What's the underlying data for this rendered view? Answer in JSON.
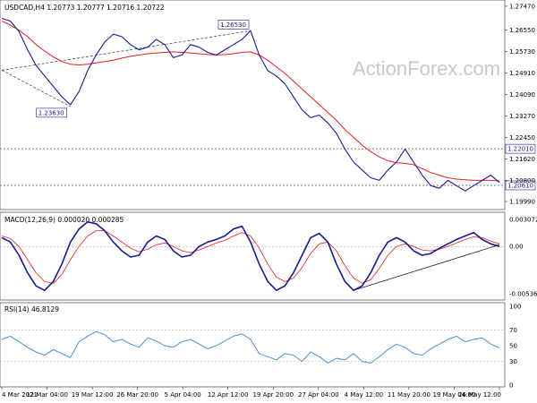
{
  "chart_data": [
    {
      "type": "line",
      "title": "USDCAD,H4  1.20773 1.20777 1.20716 1.20722",
      "watermark": "ActionForex.com",
      "x_ticks": [
        "4 Mar 2021",
        "12 Mar 04:00",
        "19 Mar 12:00",
        "26 Mar 20:00",
        "5 Apr 04:00",
        "12 Apr 12:00",
        "19 Apr 20:00",
        "27 Apr 04:00",
        "4 May 12:00",
        "11 May 20:00",
        "19 May 04:00",
        "26 May 12:00"
      ],
      "y_ticks": [
        "1.27470",
        "1.26550",
        "1.25730",
        "1.24910",
        "1.24090",
        "1.23270",
        "1.22450",
        "1.21620",
        "1.20800",
        "1.19990"
      ],
      "ylim": [
        1.1982,
        1.2757
      ],
      "price_color": "#1a1a8c",
      "ma_color": "#e02020",
      "price": [
        1.27,
        1.269,
        1.265,
        1.258,
        1.252,
        1.248,
        1.244,
        1.24,
        1.237,
        1.242,
        1.25,
        1.256,
        1.261,
        1.264,
        1.263,
        1.26,
        1.258,
        1.259,
        1.262,
        1.26,
        1.255,
        1.256,
        1.26,
        1.259,
        1.257,
        1.256,
        1.258,
        1.26,
        1.262,
        1.2653,
        1.256,
        1.25,
        1.248,
        1.245,
        1.24,
        1.235,
        1.232,
        1.233,
        1.23,
        1.226,
        1.22,
        1.215,
        1.212,
        1.209,
        1.208,
        1.212,
        1.215,
        1.22,
        1.215,
        1.21,
        1.206,
        1.205,
        1.208,
        1.206,
        1.204,
        1.206,
        1.208,
        1.21,
        1.2072
      ],
      "ma": [
        1.269,
        1.2675,
        1.2655,
        1.263,
        1.26,
        1.2575,
        1.2553,
        1.2535,
        1.2525,
        1.2522,
        1.2525,
        1.253,
        1.2535,
        1.254,
        1.2548,
        1.2555,
        1.256,
        1.2565,
        1.2568,
        1.257,
        1.2572,
        1.257,
        1.2568,
        1.2565,
        1.2562,
        1.256,
        1.2562,
        1.2565,
        1.257,
        1.2572,
        1.256,
        1.254,
        1.2515,
        1.249,
        1.246,
        1.243,
        1.24,
        1.237,
        1.234,
        1.231,
        1.2275,
        1.2245,
        1.2215,
        1.219,
        1.217,
        1.2155,
        1.2148,
        1.2145,
        1.214,
        1.2125,
        1.211,
        1.21,
        1.209,
        1.2085,
        1.2082,
        1.208,
        1.208,
        1.208,
        1.2078
      ],
      "swing_labels": [
        {
          "label": "1.23630",
          "value": 1.2363,
          "at_index": 8
        },
        {
          "label": "1.26530",
          "value": 1.2653,
          "at_index": 29
        }
      ],
      "trendline": {
        "from": {
          "index": 0,
          "value": 1.2502
        },
        "to": {
          "index": 29,
          "value": 1.2653
        }
      },
      "trendline_2": {
        "from": {
          "index": 0,
          "value": 1.2502
        },
        "to": {
          "index": 8,
          "value": 1.2363
        }
      },
      "horizontal_levels": [
        {
          "label": "1.22010",
          "value": 1.2201,
          "color": "#555555"
        },
        {
          "label": "1.20610",
          "value": 1.2061,
          "color": "#555555"
        }
      ]
    },
    {
      "type": "line",
      "title": "MACD(12,26,9) 0.000020 0.000285",
      "y_ticks": [
        "0.003072",
        "0.00",
        "-0.005369"
      ],
      "ylim": [
        -0.0058,
        0.0036
      ],
      "macd_color": "#1a1a8c",
      "signal_color": "#e02020",
      "macd": [
        0.001,
        0.0005,
        -0.001,
        -0.003,
        -0.0045,
        -0.005,
        -0.004,
        -0.002,
        0.0005,
        0.002,
        0.0028,
        0.0026,
        0.0018,
        0.0005,
        -0.0005,
        -0.0012,
        -0.001,
        0.0005,
        0.0012,
        0.0008,
        -0.0005,
        -0.0012,
        -0.001,
        0.0,
        0.0005,
        0.0008,
        0.0012,
        0.002,
        0.0023,
        0.0005,
        -0.002,
        -0.004,
        -0.005,
        -0.0045,
        -0.003,
        -0.001,
        0.001,
        0.0015,
        0.0005,
        -0.002,
        -0.004,
        -0.005,
        -0.0045,
        -0.003,
        -0.001,
        0.0005,
        0.001,
        0.0005,
        -0.0005,
        -0.001,
        -0.0008,
        -0.0002,
        0.0003,
        0.0008,
        0.0012,
        0.0016,
        0.0008,
        0.0003,
        0.0
      ],
      "signal": [
        0.0012,
        0.0009,
        0.0,
        -0.0015,
        -0.003,
        -0.004,
        -0.0042,
        -0.0032,
        -0.0015,
        0.0,
        0.0012,
        0.0018,
        0.0018,
        0.0012,
        0.0005,
        -0.0002,
        -0.0006,
        -0.0003,
        0.0002,
        0.0004,
        0.0,
        -0.0005,
        -0.0007,
        -0.0004,
        0.0,
        0.0004,
        0.0007,
        0.0012,
        0.0016,
        0.0012,
        -0.0002,
        -0.002,
        -0.0035,
        -0.004,
        -0.0036,
        -0.0024,
        -0.0008,
        0.0003,
        0.0005,
        -0.0005,
        -0.0022,
        -0.0036,
        -0.0042,
        -0.0038,
        -0.0025,
        -0.001,
        0.0,
        0.0003,
        0.0,
        -0.0004,
        -0.0005,
        -0.0003,
        0.0,
        0.0004,
        0.0008,
        0.0011,
        0.001,
        0.0006,
        0.0003
      ],
      "trendline": {
        "from": {
          "index": 41,
          "value": -0.005
        },
        "to": {
          "index": 58,
          "value": 0.0002
        }
      }
    },
    {
      "type": "line",
      "title": "RSI(14) 46.8129",
      "y_ticks": [
        "100",
        "70",
        "50",
        "30",
        "0"
      ],
      "ylim": [
        0,
        100
      ],
      "levels": [
        70,
        30
      ],
      "rsi_color": "#4a90d9",
      "rsi": [
        58,
        62,
        55,
        48,
        42,
        38,
        45,
        40,
        35,
        55,
        62,
        68,
        64,
        55,
        58,
        52,
        48,
        60,
        56,
        50,
        48,
        55,
        58,
        52,
        46,
        50,
        56,
        62,
        65,
        58,
        40,
        36,
        32,
        40,
        38,
        30,
        42,
        36,
        28,
        34,
        32,
        40,
        30,
        28,
        36,
        45,
        52,
        48,
        40,
        38,
        46,
        52,
        58,
        62,
        55,
        58,
        60,
        52,
        47
      ]
    }
  ]
}
